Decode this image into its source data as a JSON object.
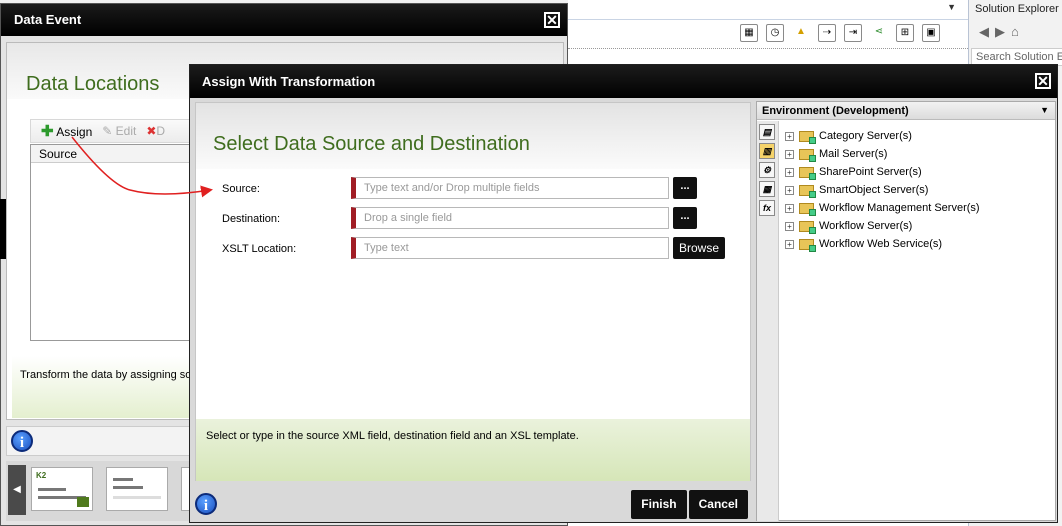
{
  "ide": {
    "solution_explorer_title": "Solution Explorer",
    "search_placeholder": "Search Solution Explorer"
  },
  "data_event": {
    "title": "Data Event",
    "section_title": "Data Locations",
    "toolbar": {
      "assign": "Assign",
      "edit": "Edit",
      "delete": "D"
    },
    "grid_column": "Source",
    "note": "Transform the data by assigning source and destination fields"
  },
  "assign_dialog": {
    "title": "Assign With Transformation",
    "section_title": "Select Data Source and Destination",
    "fields": {
      "source_label": "Source:",
      "source_placeholder": "Type text and/or Drop multiple fields",
      "destination_label": "Destination:",
      "destination_placeholder": "Drop a single field",
      "xslt_label": "XSLT Location:",
      "xslt_placeholder": "Type text"
    },
    "ellipsis_label": "...",
    "browse_label": "Browse",
    "note": "Select or type in the source XML field, destination field and an XSL template.",
    "finish_label": "Finish",
    "cancel_label": "Cancel"
  },
  "environment": {
    "title": "Environment (Development)",
    "items": [
      "Category Server(s)",
      "Mail Server(s)",
      "SharePoint Server(s)",
      "SmartObject Server(s)",
      "Workflow Management Server(s)",
      "Workflow Server(s)",
      "Workflow Web Service(s)"
    ]
  },
  "colors": {
    "title_green": "#3f6d1e",
    "required_marker": "#a11d25",
    "arrow_red": "#e02020"
  }
}
